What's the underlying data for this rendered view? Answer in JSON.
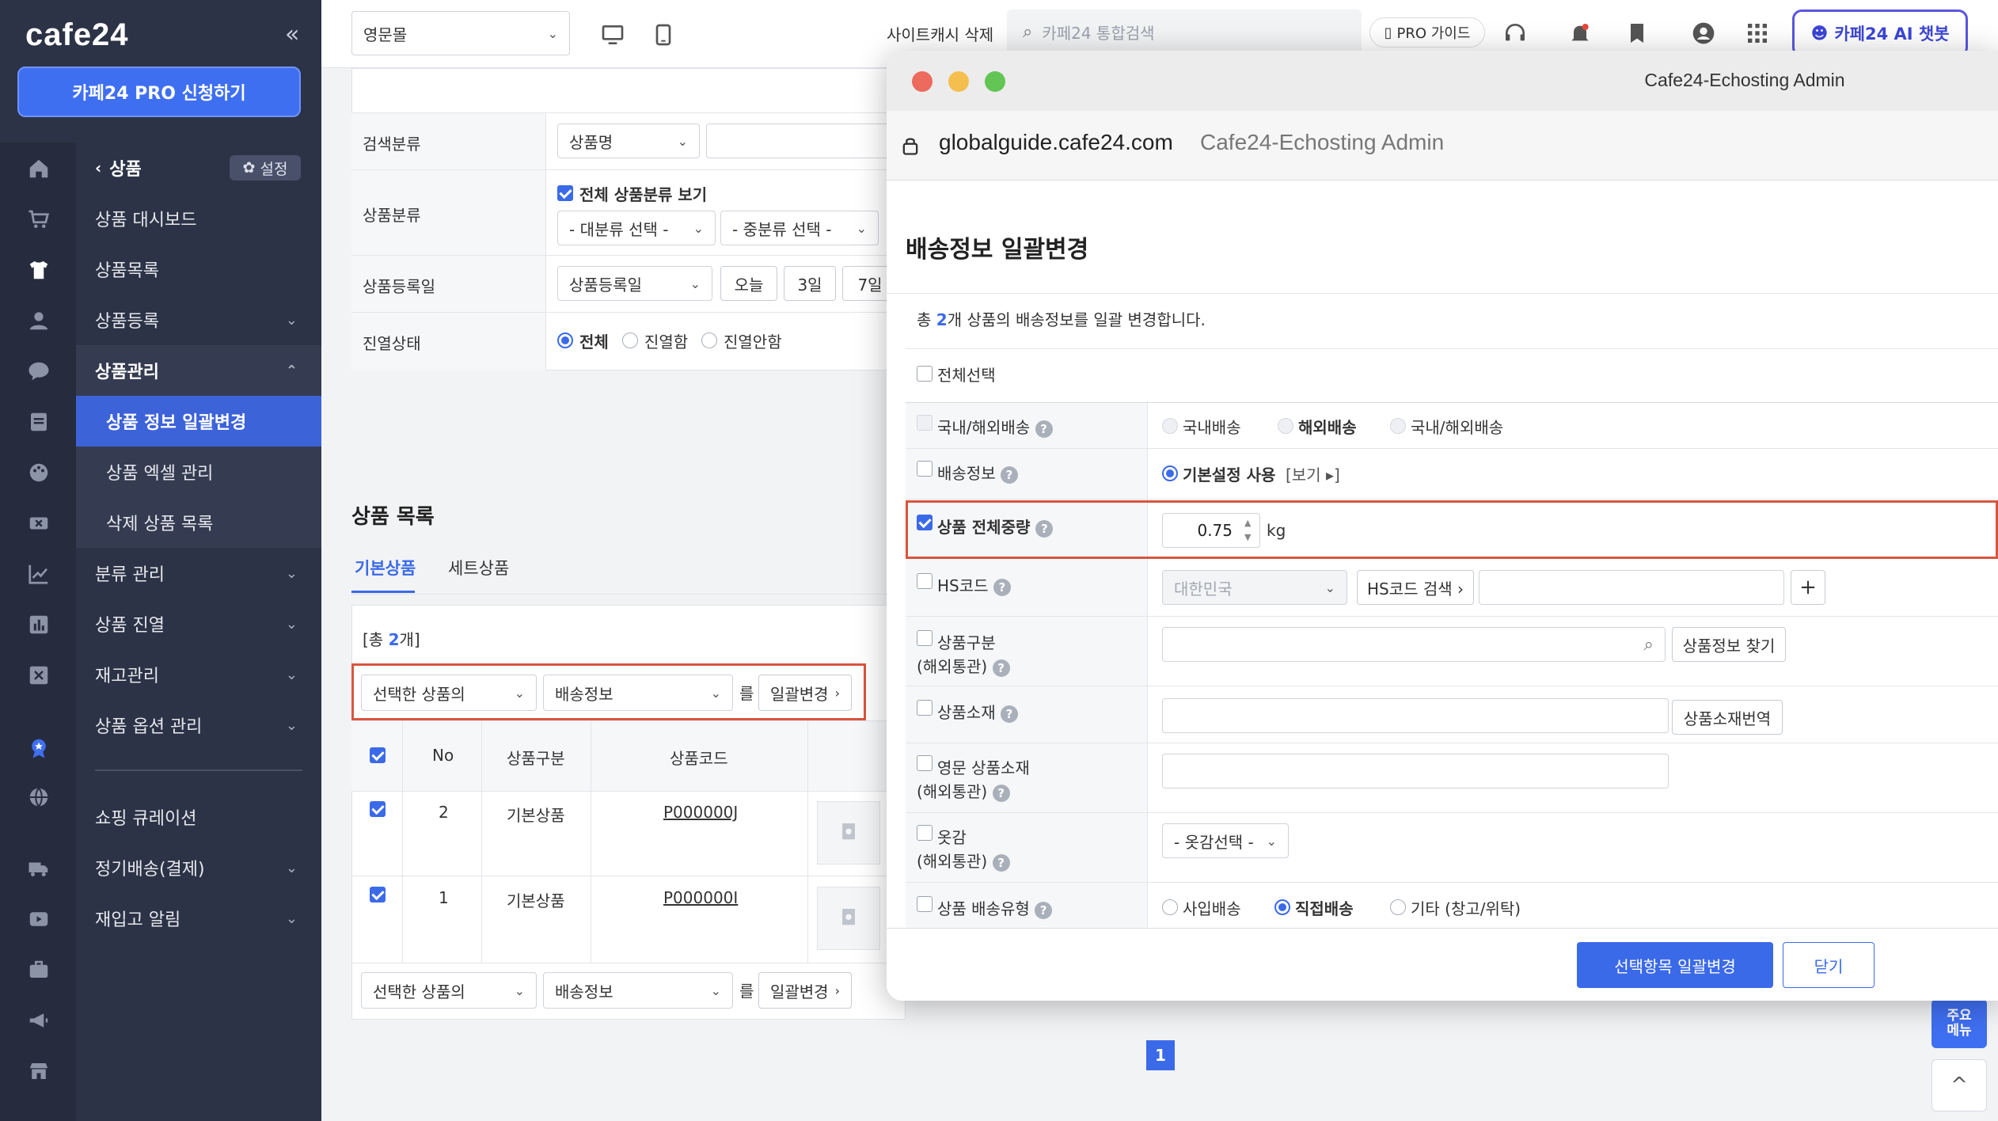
{
  "sidebar": {
    "logo": "cafe24",
    "collapse_icon": "«",
    "pro_button": "카페24 PRO 신청하기",
    "section_back": "상품",
    "settings_label": "설정",
    "items": [
      {
        "label": "상품 대시보드"
      },
      {
        "label": "상품목록"
      },
      {
        "label": "상품등록"
      },
      {
        "label": "상품관리"
      },
      {
        "label": "상품 정보 일괄변경"
      },
      {
        "label": "상품 엑셀 관리"
      },
      {
        "label": "삭제 상품 목록"
      },
      {
        "label": "분류 관리"
      },
      {
        "label": "상품 진열"
      },
      {
        "label": "재고관리"
      },
      {
        "label": "상품 옵션 관리"
      },
      {
        "label": "쇼핑 큐레이션"
      },
      {
        "label": "정기배송(결제)"
      },
      {
        "label": "재입고 알림"
      }
    ]
  },
  "topbar": {
    "shop_select": "영문몰",
    "cache_delete": "사이트캐시 삭제",
    "search_placeholder": "카페24 통합검색",
    "pro_guide": "PRO 가이드",
    "ai_chatbot": "카페24 AI 챗봇"
  },
  "search_form": {
    "rows": [
      {
        "label": "검색분류",
        "select": "상품명"
      },
      {
        "label": "상품분류",
        "checkbox": "전체 상품분류 보기",
        "select1": "- 대분류 선택 -",
        "select2": "- 중분류 선택 -"
      },
      {
        "label": "상품등록일",
        "select": "상품등록일",
        "btn_today": "오늘",
        "btn_3d": "3일",
        "btn_7d": "7일"
      },
      {
        "label": "진열상태",
        "opt_all": "전체",
        "opt_on": "진열함",
        "opt_off": "진열안함"
      }
    ]
  },
  "product_list": {
    "title": "상품 목록",
    "tabs": [
      "기본상품",
      "세트상품"
    ],
    "total_prefix": "[총 ",
    "total_count": "2",
    "total_suffix": "개]",
    "bulk_select1": "선택한 상품의",
    "bulk_select2": "배송정보",
    "bulk_particle": "를",
    "bulk_button": "일괄변경",
    "columns": [
      "No",
      "상품구분",
      "상품코드"
    ],
    "rows": [
      {
        "no": "2",
        "type": "기본상품",
        "code": "P000000J"
      },
      {
        "no": "1",
        "type": "기본상품",
        "code": "P000000I"
      }
    ],
    "page": "1"
  },
  "floating": {
    "main_menu": "주요\n메뉴",
    "top": "^"
  },
  "modal": {
    "window_title": "Cafe24-Echosting Admin",
    "url_domain": "globalguide.cafe24.com",
    "url_title": "Cafe24-Echosting Admin",
    "heading": "배송정보 일괄변경",
    "info_prefix": "총 ",
    "info_count": "2",
    "info_suffix": "개 상품의 배송정보를 일괄 변경합니다.",
    "select_all": "전체선택",
    "fields": {
      "domestic_intl": {
        "label": "국내/해외배송",
        "opt1": "국내배송",
        "opt2": "해외배송",
        "opt3": "국내/해외배송"
      },
      "shipping_info": {
        "label": "배송정보",
        "opt": "기본설정 사용",
        "view": "[보기 ▸]"
      },
      "total_weight": {
        "label": "상품 전체중량",
        "value": "0.75",
        "unit": "kg"
      },
      "hs_code": {
        "label": "HS코드",
        "country": "대한민국",
        "search_btn": "HS코드 검색 ›",
        "add": "+"
      },
      "product_type": {
        "label": "상품구분",
        "label2": "(해외통관)",
        "btn": "상품정보 찾기"
      },
      "material": {
        "label": "상품소재",
        "btn": "상품소재번역"
      },
      "en_material": {
        "label": "영문 상품소재",
        "label2": "(해외통관)"
      },
      "fabric": {
        "label": "옷감",
        "label2": "(해외통관)",
        "select": "- 옷감선택 -"
      },
      "delivery_type": {
        "label": "상품 배송유형",
        "opt1": "사입배송",
        "opt2": "직접배송",
        "opt3": "기타 (창고/위탁)"
      }
    },
    "apply_button": "선택항목 일괄변경",
    "close_button": "닫기"
  }
}
